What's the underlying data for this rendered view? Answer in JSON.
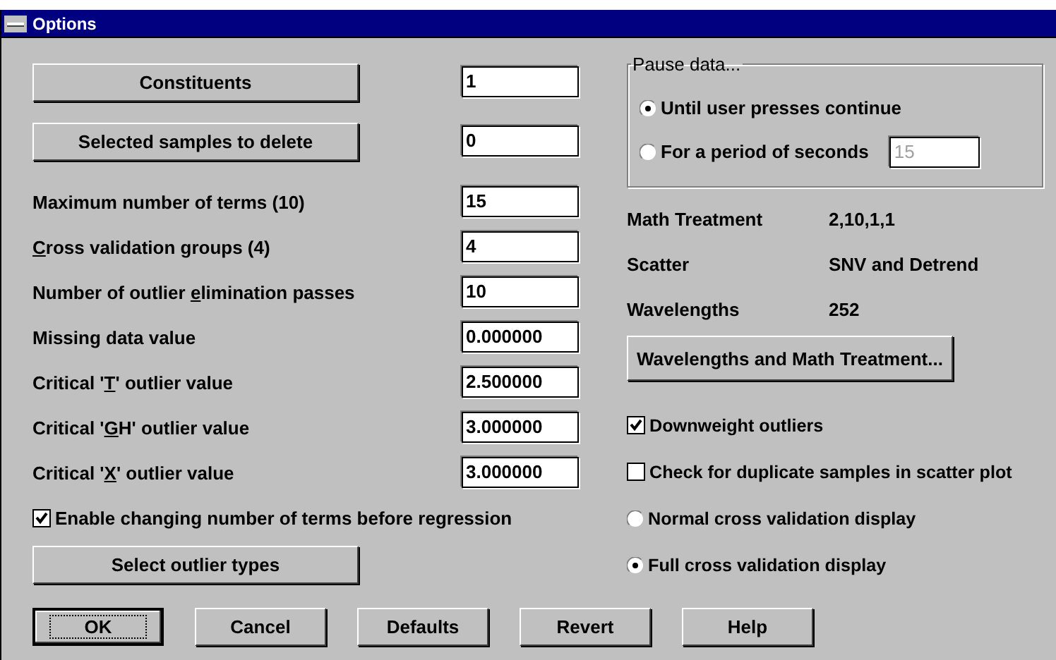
{
  "window": {
    "title": "Options"
  },
  "left": {
    "action_rows": [
      {
        "button": "Constituents",
        "value": "1"
      },
      {
        "button": "Selected samples to delete",
        "value": "0"
      }
    ],
    "fields": [
      {
        "label_before": "Maximum number of terms (10)",
        "value": "15"
      },
      {
        "access_key": "C",
        "label_after": "ross validation groups (4)",
        "value": "4"
      },
      {
        "label_before": "Number of outlier ",
        "access_key": "e",
        "label_after": "limination passes",
        "value": "10"
      },
      {
        "label_before": "Missing data value",
        "value": "0.000000"
      },
      {
        "label_before": "Critical '",
        "access_key": "T",
        "label_after": "' outlier value",
        "value": "2.500000"
      },
      {
        "label_before": "Critical '",
        "access_key": "G",
        "label_after": "H' outlier value",
        "value": "3.000000"
      },
      {
        "label_before": "Critical '",
        "access_key": "X",
        "label_after": "' outlier value",
        "value": "3.000000"
      }
    ],
    "checkbox": {
      "label": "Enable changing number of terms before regression",
      "checked": true
    },
    "button": "Select outlier types"
  },
  "right": {
    "pause_group": {
      "title": "Pause data...",
      "options": [
        {
          "label": "Until user presses continue",
          "selected": true
        },
        {
          "label": "For a period of seconds",
          "selected": false,
          "field": {
            "value": "15",
            "disabled": true
          }
        }
      ]
    },
    "info": [
      {
        "label": "Math Treatment",
        "value": "2,10,1,1"
      },
      {
        "label": "Scatter",
        "value": "SNV and Detrend"
      },
      {
        "label": "Wavelengths",
        "value": "252"
      }
    ],
    "button": "Wavelengths and Math Treatment...",
    "options": [
      {
        "kind": "checkbox",
        "label": "Downweight outliers",
        "checked": true
      },
      {
        "kind": "checkbox",
        "label": "Check for duplicate samples in scatter plot",
        "checked": false
      },
      {
        "kind": "radio",
        "label": "Normal cross validation display",
        "selected": false
      },
      {
        "kind": "radio",
        "label": "Full cross validation display",
        "selected": true
      }
    ]
  },
  "buttons": [
    {
      "label": "OK",
      "default": true
    },
    {
      "label": "Cancel",
      "default": false
    },
    {
      "label": "Defaults",
      "default": false
    },
    {
      "label": "Revert",
      "default": false
    },
    {
      "label": "Help",
      "default": false
    }
  ]
}
